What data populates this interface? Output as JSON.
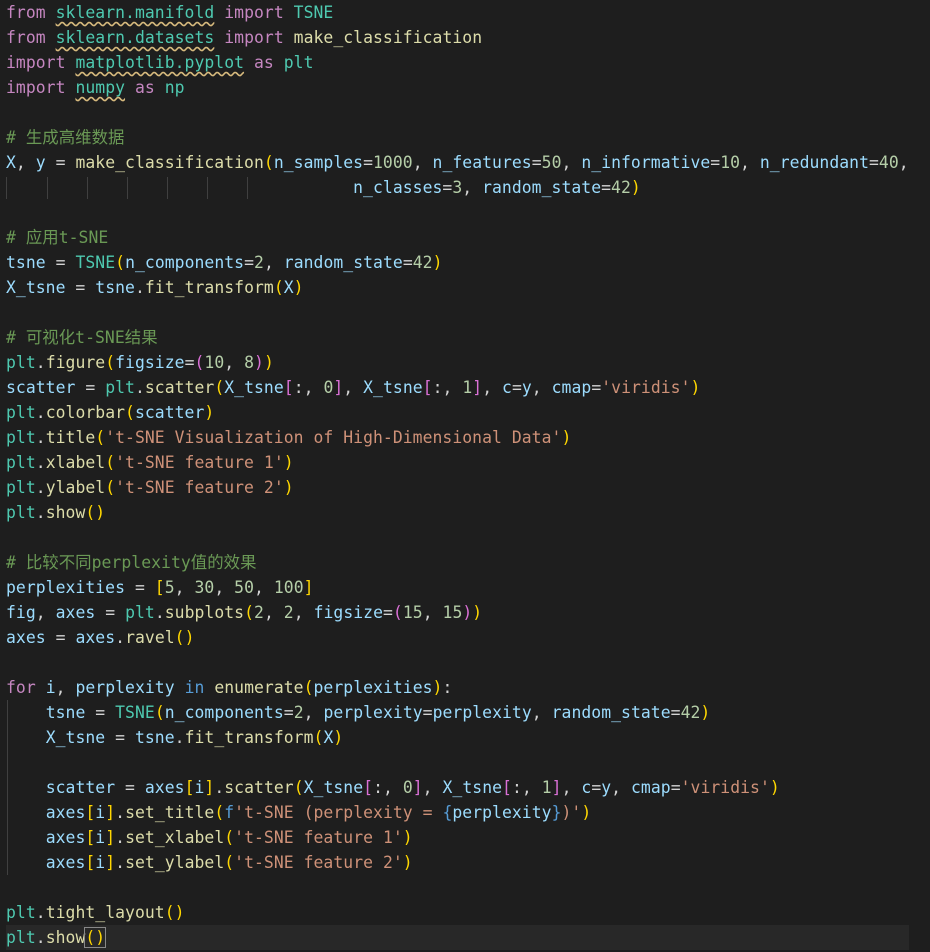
{
  "editor": {
    "language": "python",
    "lines": [
      [
        [
          "k",
          "from"
        ],
        [
          "p",
          " "
        ],
        [
          "t sq",
          "sklearn.manifold"
        ],
        [
          "p",
          " "
        ],
        [
          "k",
          "import"
        ],
        [
          "p",
          " "
        ],
        [
          "t",
          "TSNE"
        ]
      ],
      [
        [
          "k",
          "from"
        ],
        [
          "p",
          " "
        ],
        [
          "t sq",
          "sklearn.datasets"
        ],
        [
          "p",
          " "
        ],
        [
          "k",
          "import"
        ],
        [
          "p",
          " "
        ],
        [
          "f",
          "make_classification"
        ]
      ],
      [
        [
          "k",
          "import"
        ],
        [
          "p",
          " "
        ],
        [
          "t sq",
          "matplotlib.pyplot"
        ],
        [
          "p",
          " "
        ],
        [
          "k",
          "as"
        ],
        [
          "p",
          " "
        ],
        [
          "t",
          "plt"
        ]
      ],
      [
        [
          "k",
          "import"
        ],
        [
          "p",
          " "
        ],
        [
          "t sq",
          "numpy"
        ],
        [
          "p",
          " "
        ],
        [
          "k",
          "as"
        ],
        [
          "p",
          " "
        ],
        [
          "t",
          "np"
        ]
      ],
      [],
      [
        [
          "c",
          "# 生成高维数据"
        ]
      ],
      [
        [
          "v",
          "X"
        ],
        [
          "p",
          ", "
        ],
        [
          "v",
          "y"
        ],
        [
          "p",
          " = "
        ],
        [
          "f",
          "make_classification"
        ],
        [
          "b1",
          "("
        ],
        [
          "v",
          "n_samples"
        ],
        [
          "p",
          "="
        ],
        [
          "n",
          "1000"
        ],
        [
          "p",
          ", "
        ],
        [
          "v",
          "n_features"
        ],
        [
          "p",
          "="
        ],
        [
          "n",
          "50"
        ],
        [
          "p",
          ", "
        ],
        [
          "v",
          "n_informative"
        ],
        [
          "p",
          "="
        ],
        [
          "n",
          "10"
        ],
        [
          "p",
          ", "
        ],
        [
          "v",
          "n_redundant"
        ],
        [
          "p",
          "="
        ],
        [
          "n",
          "40"
        ],
        [
          "p",
          ","
        ]
      ],
      [
        [
          "p",
          "                                   "
        ],
        [
          "v",
          "n_classes"
        ],
        [
          "p",
          "="
        ],
        [
          "n",
          "3"
        ],
        [
          "p",
          ", "
        ],
        [
          "v",
          "random_state"
        ],
        [
          "p",
          "="
        ],
        [
          "n",
          "42"
        ],
        [
          "b1",
          ")"
        ]
      ],
      [],
      [
        [
          "c",
          "# 应用t-SNE"
        ]
      ],
      [
        [
          "v",
          "tsne"
        ],
        [
          "p",
          " = "
        ],
        [
          "t",
          "TSNE"
        ],
        [
          "b1",
          "("
        ],
        [
          "v",
          "n_components"
        ],
        [
          "p",
          "="
        ],
        [
          "n",
          "2"
        ],
        [
          "p",
          ", "
        ],
        [
          "v",
          "random_state"
        ],
        [
          "p",
          "="
        ],
        [
          "n",
          "42"
        ],
        [
          "b1",
          ")"
        ]
      ],
      [
        [
          "v",
          "X_tsne"
        ],
        [
          "p",
          " = "
        ],
        [
          "v",
          "tsne"
        ],
        [
          "p",
          "."
        ],
        [
          "f",
          "fit_transform"
        ],
        [
          "b1",
          "("
        ],
        [
          "v",
          "X"
        ],
        [
          "b1",
          ")"
        ]
      ],
      [],
      [
        [
          "c",
          "# 可视化t-SNE结果"
        ]
      ],
      [
        [
          "t",
          "plt"
        ],
        [
          "p",
          "."
        ],
        [
          "f",
          "figure"
        ],
        [
          "b1",
          "("
        ],
        [
          "v",
          "figsize"
        ],
        [
          "p",
          "="
        ],
        [
          "b2",
          "("
        ],
        [
          "n",
          "10"
        ],
        [
          "p",
          ", "
        ],
        [
          "n",
          "8"
        ],
        [
          "b2",
          ")"
        ],
        [
          "b1",
          ")"
        ]
      ],
      [
        [
          "v",
          "scatter"
        ],
        [
          "p",
          " = "
        ],
        [
          "t",
          "plt"
        ],
        [
          "p",
          "."
        ],
        [
          "f",
          "scatter"
        ],
        [
          "b1",
          "("
        ],
        [
          "v",
          "X_tsne"
        ],
        [
          "b2",
          "["
        ],
        [
          "p",
          ":, "
        ],
        [
          "n",
          "0"
        ],
        [
          "b2",
          "]"
        ],
        [
          "p",
          ", "
        ],
        [
          "v",
          "X_tsne"
        ],
        [
          "b2",
          "["
        ],
        [
          "p",
          ":, "
        ],
        [
          "n",
          "1"
        ],
        [
          "b2",
          "]"
        ],
        [
          "p",
          ", "
        ],
        [
          "v",
          "c"
        ],
        [
          "p",
          "="
        ],
        [
          "v",
          "y"
        ],
        [
          "p",
          ", "
        ],
        [
          "v",
          "cmap"
        ],
        [
          "p",
          "="
        ],
        [
          "s",
          "'viridis'"
        ],
        [
          "b1",
          ")"
        ]
      ],
      [
        [
          "t",
          "plt"
        ],
        [
          "p",
          "."
        ],
        [
          "f",
          "colorbar"
        ],
        [
          "b1",
          "("
        ],
        [
          "v",
          "scatter"
        ],
        [
          "b1",
          ")"
        ]
      ],
      [
        [
          "t",
          "plt"
        ],
        [
          "p",
          "."
        ],
        [
          "f",
          "title"
        ],
        [
          "b1",
          "("
        ],
        [
          "s",
          "'t-SNE Visualization of High-Dimensional Data'"
        ],
        [
          "b1",
          ")"
        ]
      ],
      [
        [
          "t",
          "plt"
        ],
        [
          "p",
          "."
        ],
        [
          "f",
          "xlabel"
        ],
        [
          "b1",
          "("
        ],
        [
          "s",
          "'t-SNE feature 1'"
        ],
        [
          "b1",
          ")"
        ]
      ],
      [
        [
          "t",
          "plt"
        ],
        [
          "p",
          "."
        ],
        [
          "f",
          "ylabel"
        ],
        [
          "b1",
          "("
        ],
        [
          "s",
          "'t-SNE feature 2'"
        ],
        [
          "b1",
          ")"
        ]
      ],
      [
        [
          "t",
          "plt"
        ],
        [
          "p",
          "."
        ],
        [
          "f",
          "show"
        ],
        [
          "b1",
          "()"
        ]
      ],
      [],
      [
        [
          "c",
          "# 比较不同perplexity值的效果"
        ]
      ],
      [
        [
          "v",
          "perplexities"
        ],
        [
          "p",
          " = "
        ],
        [
          "b1",
          "["
        ],
        [
          "n",
          "5"
        ],
        [
          "p",
          ", "
        ],
        [
          "n",
          "30"
        ],
        [
          "p",
          ", "
        ],
        [
          "n",
          "50"
        ],
        [
          "p",
          ", "
        ],
        [
          "n",
          "100"
        ],
        [
          "b1",
          "]"
        ]
      ],
      [
        [
          "v",
          "fig"
        ],
        [
          "p",
          ", "
        ],
        [
          "v",
          "axes"
        ],
        [
          "p",
          " = "
        ],
        [
          "t",
          "plt"
        ],
        [
          "p",
          "."
        ],
        [
          "f",
          "subplots"
        ],
        [
          "b1",
          "("
        ],
        [
          "n",
          "2"
        ],
        [
          "p",
          ", "
        ],
        [
          "n",
          "2"
        ],
        [
          "p",
          ", "
        ],
        [
          "v",
          "figsize"
        ],
        [
          "p",
          "="
        ],
        [
          "b2",
          "("
        ],
        [
          "n",
          "15"
        ],
        [
          "p",
          ", "
        ],
        [
          "n",
          "15"
        ],
        [
          "b2",
          ")"
        ],
        [
          "b1",
          ")"
        ]
      ],
      [
        [
          "v",
          "axes"
        ],
        [
          "p",
          " = "
        ],
        [
          "v",
          "axes"
        ],
        [
          "p",
          "."
        ],
        [
          "f",
          "ravel"
        ],
        [
          "b1",
          "()"
        ]
      ],
      [],
      [
        [
          "k",
          "for"
        ],
        [
          "p",
          " "
        ],
        [
          "v",
          "i"
        ],
        [
          "p",
          ", "
        ],
        [
          "v",
          "perplexity"
        ],
        [
          "p",
          " "
        ],
        [
          "kw",
          "in"
        ],
        [
          "p",
          " "
        ],
        [
          "f",
          "enumerate"
        ],
        [
          "b1",
          "("
        ],
        [
          "v",
          "perplexities"
        ],
        [
          "b1",
          ")"
        ],
        [
          "p",
          ":"
        ]
      ],
      [
        [
          "p",
          "    "
        ],
        [
          "v",
          "tsne"
        ],
        [
          "p",
          " = "
        ],
        [
          "t",
          "TSNE"
        ],
        [
          "b1",
          "("
        ],
        [
          "v",
          "n_components"
        ],
        [
          "p",
          "="
        ],
        [
          "n",
          "2"
        ],
        [
          "p",
          ", "
        ],
        [
          "v",
          "perplexity"
        ],
        [
          "p",
          "="
        ],
        [
          "v",
          "perplexity"
        ],
        [
          "p",
          ", "
        ],
        [
          "v",
          "random_state"
        ],
        [
          "p",
          "="
        ],
        [
          "n",
          "42"
        ],
        [
          "b1",
          ")"
        ]
      ],
      [
        [
          "p",
          "    "
        ],
        [
          "v",
          "X_tsne"
        ],
        [
          "p",
          " = "
        ],
        [
          "v",
          "tsne"
        ],
        [
          "p",
          "."
        ],
        [
          "f",
          "fit_transform"
        ],
        [
          "b1",
          "("
        ],
        [
          "v",
          "X"
        ],
        [
          "b1",
          ")"
        ]
      ],
      [],
      [
        [
          "p",
          "    "
        ],
        [
          "v",
          "scatter"
        ],
        [
          "p",
          " = "
        ],
        [
          "v",
          "axes"
        ],
        [
          "b1",
          "["
        ],
        [
          "v",
          "i"
        ],
        [
          "b1",
          "]"
        ],
        [
          "p",
          "."
        ],
        [
          "f",
          "scatter"
        ],
        [
          "b1",
          "("
        ],
        [
          "v",
          "X_tsne"
        ],
        [
          "b2",
          "["
        ],
        [
          "p",
          ":, "
        ],
        [
          "n",
          "0"
        ],
        [
          "b2",
          "]"
        ],
        [
          "p",
          ", "
        ],
        [
          "v",
          "X_tsne"
        ],
        [
          "b2",
          "["
        ],
        [
          "p",
          ":, "
        ],
        [
          "n",
          "1"
        ],
        [
          "b2",
          "]"
        ],
        [
          "p",
          ", "
        ],
        [
          "v",
          "c"
        ],
        [
          "p",
          "="
        ],
        [
          "v",
          "y"
        ],
        [
          "p",
          ", "
        ],
        [
          "v",
          "cmap"
        ],
        [
          "p",
          "="
        ],
        [
          "s",
          "'viridis'"
        ],
        [
          "b1",
          ")"
        ]
      ],
      [
        [
          "p",
          "    "
        ],
        [
          "v",
          "axes"
        ],
        [
          "b1",
          "["
        ],
        [
          "v",
          "i"
        ],
        [
          "b1",
          "]"
        ],
        [
          "p",
          "."
        ],
        [
          "f",
          "set_title"
        ],
        [
          "b1",
          "("
        ],
        [
          "kw",
          "f"
        ],
        [
          "s",
          "'t-SNE (perplexity = "
        ],
        [
          "kw",
          "{"
        ],
        [
          "v",
          "perplexity"
        ],
        [
          "kw",
          "}"
        ],
        [
          "s",
          ")'"
        ],
        [
          "b1",
          ")"
        ]
      ],
      [
        [
          "p",
          "    "
        ],
        [
          "v",
          "axes"
        ],
        [
          "b1",
          "["
        ],
        [
          "v",
          "i"
        ],
        [
          "b1",
          "]"
        ],
        [
          "p",
          "."
        ],
        [
          "f",
          "set_xlabel"
        ],
        [
          "b1",
          "("
        ],
        [
          "s",
          "'t-SNE feature 1'"
        ],
        [
          "b1",
          ")"
        ]
      ],
      [
        [
          "p",
          "    "
        ],
        [
          "v",
          "axes"
        ],
        [
          "b1",
          "["
        ],
        [
          "v",
          "i"
        ],
        [
          "b1",
          "]"
        ],
        [
          "p",
          "."
        ],
        [
          "f",
          "set_ylabel"
        ],
        [
          "b1",
          "("
        ],
        [
          "s",
          "'t-SNE feature 2'"
        ],
        [
          "b1",
          ")"
        ]
      ],
      [],
      [
        [
          "t",
          "plt"
        ],
        [
          "p",
          "."
        ],
        [
          "f",
          "tight_layout"
        ],
        [
          "b1",
          "()"
        ]
      ],
      [
        [
          "t",
          "plt"
        ],
        [
          "p",
          "."
        ],
        [
          "f",
          "show"
        ],
        [
          "b1 cursor-box",
          "()"
        ]
      ]
    ],
    "current_line": 37
  }
}
